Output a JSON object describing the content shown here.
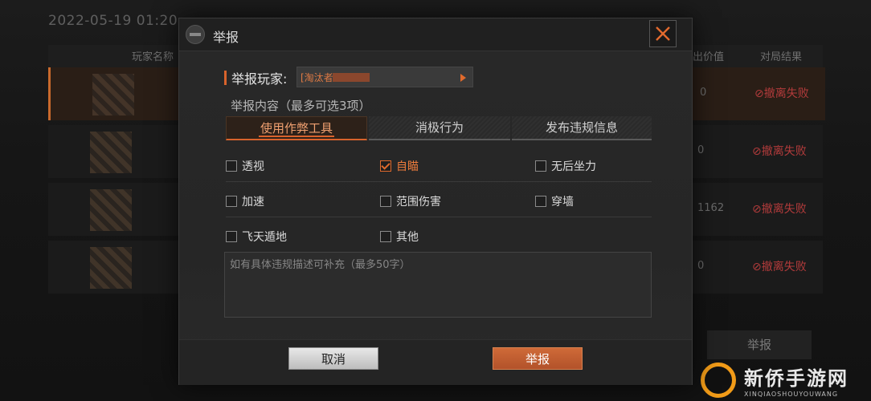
{
  "background": {
    "date": "2022-05-19 01:20",
    "columns": [
      "玩家名称",
      "出价值",
      "对局结果"
    ],
    "rows": [
      {
        "value": "0",
        "result": "⊘撤离失败"
      },
      {
        "value": "0",
        "result": "⊘撤离失败"
      },
      {
        "value": "1162",
        "result": "⊘撤离失败"
      },
      {
        "value": "0",
        "result": "⊘撤离失败"
      }
    ],
    "report_button": "举报"
  },
  "modal": {
    "title": "举报",
    "player_label": "举报玩家:",
    "player_name": "[淘汰者",
    "content_label": "举报内容（最多可选3项）",
    "tabs": [
      {
        "label": "使用作弊工具",
        "active": true
      },
      {
        "label": "消极行为",
        "active": false
      },
      {
        "label": "发布违规信息",
        "active": false
      }
    ],
    "options": [
      {
        "label": "透视",
        "checked": false
      },
      {
        "label": "自瞄",
        "checked": true
      },
      {
        "label": "无后坐力",
        "checked": false
      },
      {
        "label": "加速",
        "checked": false
      },
      {
        "label": "范围伤害",
        "checked": false
      },
      {
        "label": "穿墙",
        "checked": false
      },
      {
        "label": "飞天遁地",
        "checked": false
      },
      {
        "label": "其他",
        "checked": false
      }
    ],
    "description_placeholder": "如有具体违规描述可补充（最多50字）",
    "cancel_button": "取消",
    "report_button": "举报"
  },
  "watermark": {
    "name_cn": "新侨手游网",
    "name_en": "XINQIAOSHOUYOUWANG"
  },
  "colors": {
    "accent": "#d8632c",
    "checked": "#e06a2c",
    "danger": "#b23b3b"
  }
}
